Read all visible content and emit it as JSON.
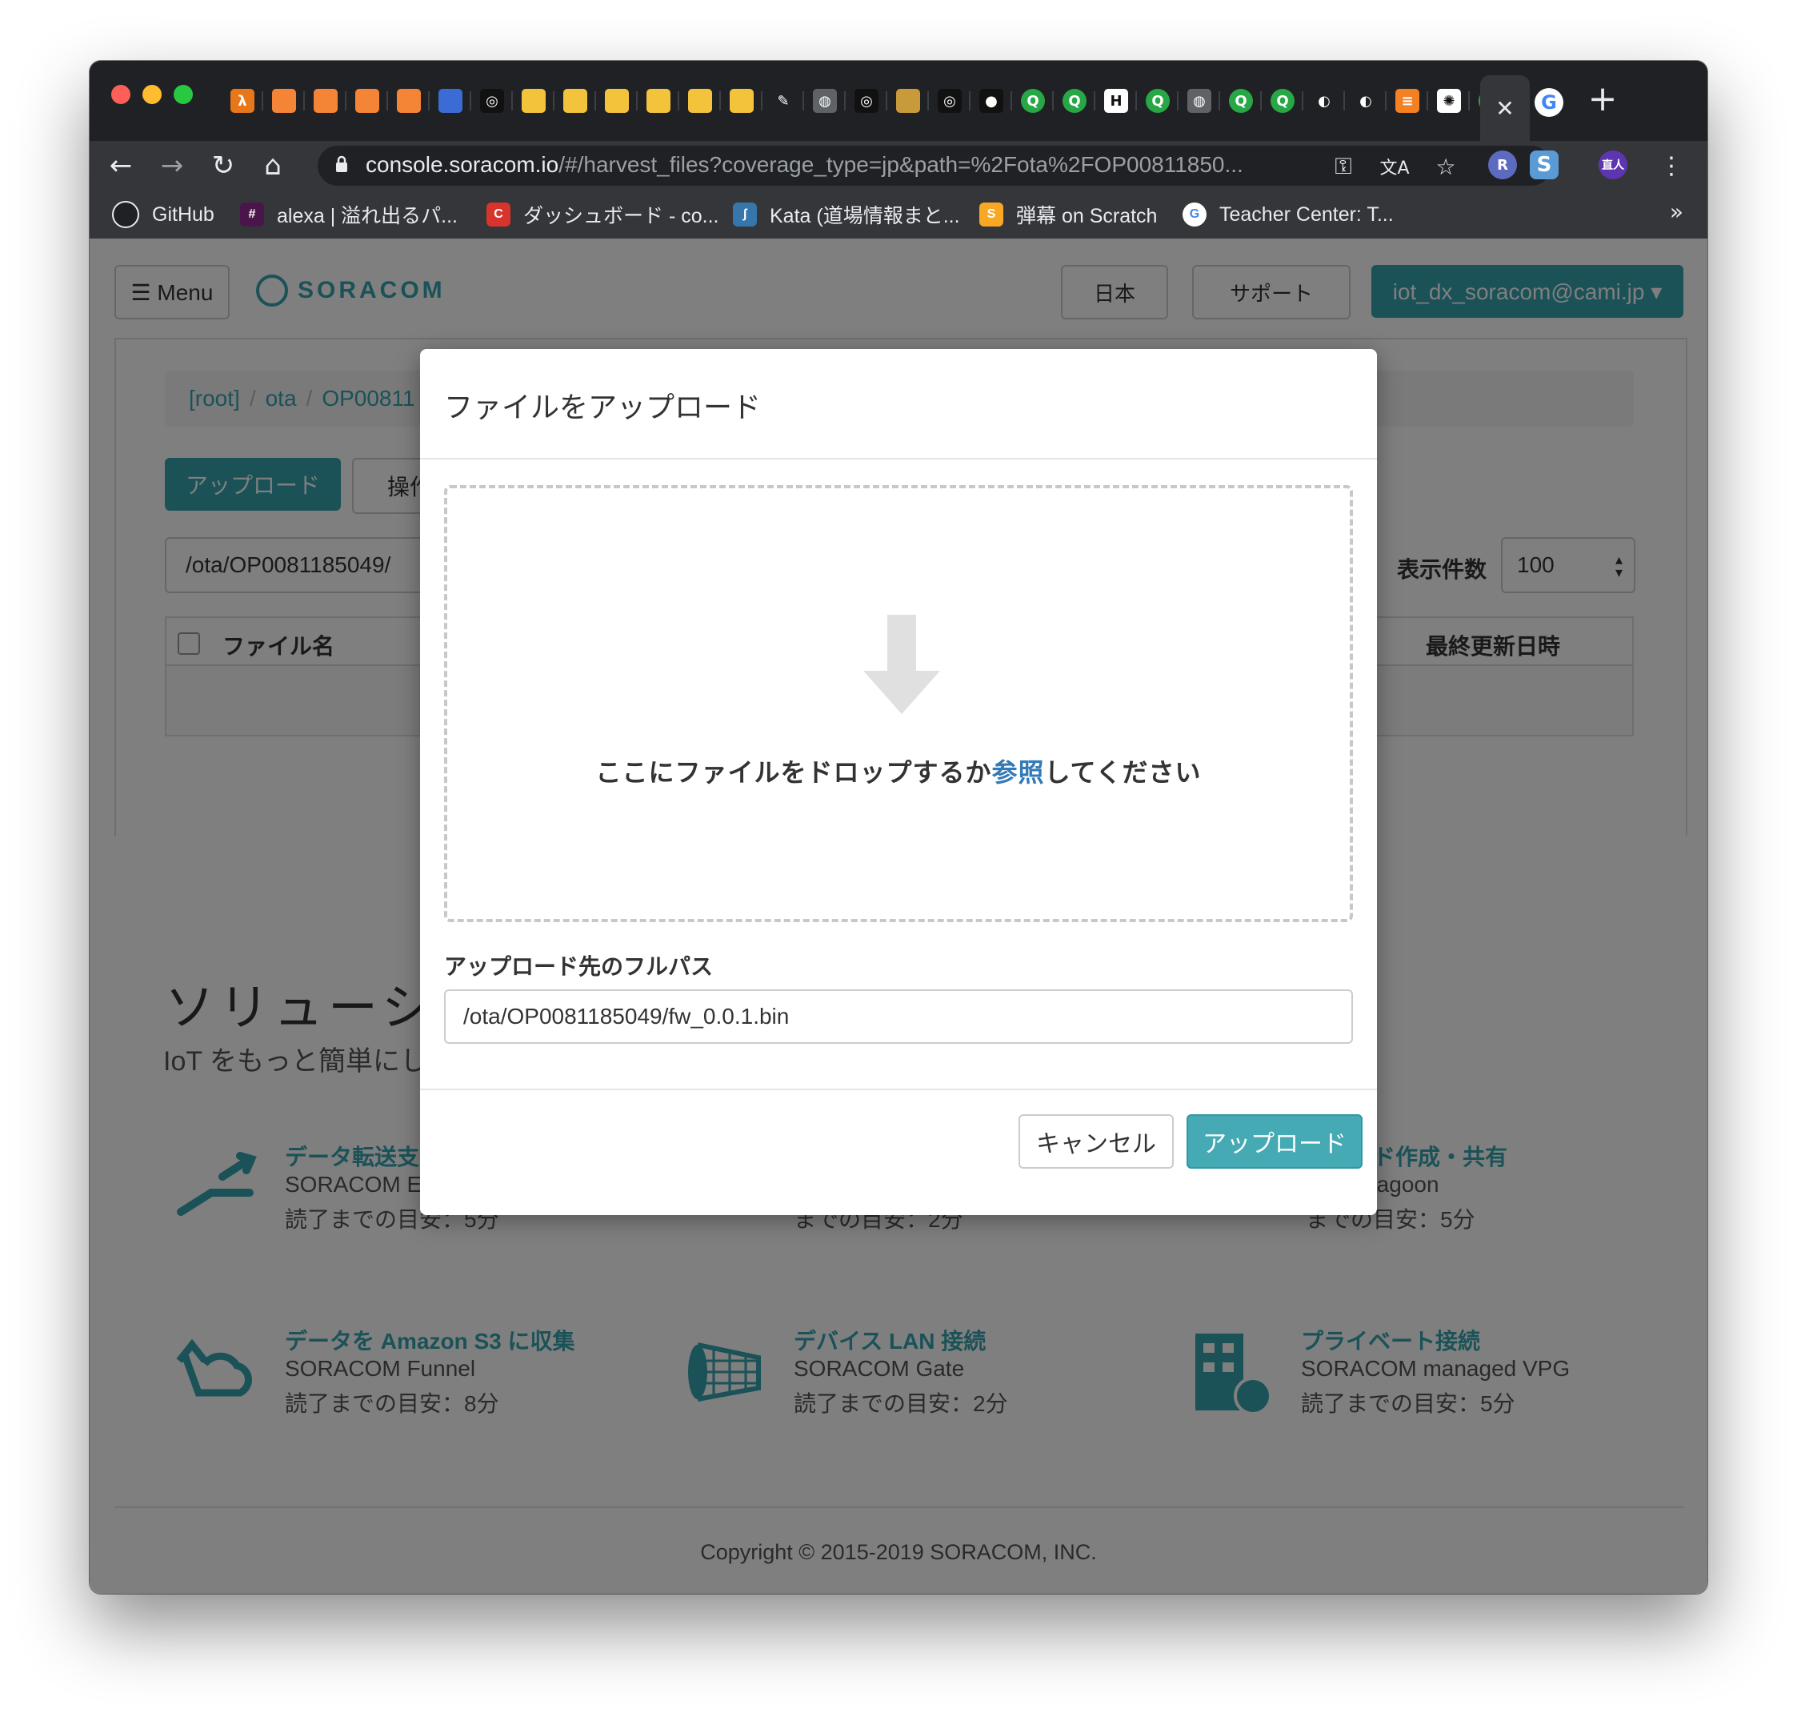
{
  "browser": {
    "tab_icons": [
      {
        "name": "aws-lambda-icon",
        "color": "#e8761a",
        "glyph": "λ"
      },
      {
        "name": "aws-box-icon",
        "color": "#f58536",
        "glyph": ""
      },
      {
        "name": "aws-box-icon",
        "color": "#f58536",
        "glyph": ""
      },
      {
        "name": "aws-box-icon",
        "color": "#f58536",
        "glyph": ""
      },
      {
        "name": "aws-box-icon",
        "color": "#f58536",
        "glyph": ""
      },
      {
        "name": "database-icon",
        "color": "#3b6bd4",
        "glyph": ""
      },
      {
        "name": "circle-logo-icon",
        "color": "#111111",
        "glyph": "◎"
      },
      {
        "name": "package-icon",
        "color": "#f3c33c",
        "glyph": ""
      },
      {
        "name": "package-icon",
        "color": "#f3c33c",
        "glyph": ""
      },
      {
        "name": "package-icon",
        "color": "#f3c33c",
        "glyph": ""
      },
      {
        "name": "package-icon",
        "color": "#f3c33c",
        "glyph": ""
      },
      {
        "name": "package-icon",
        "color": "#f3c33c",
        "glyph": ""
      },
      {
        "name": "package-icon",
        "color": "#f3c33c",
        "glyph": ""
      },
      {
        "name": "pen-icon",
        "color": "#202124",
        "glyph": "✎"
      },
      {
        "name": "globe-icon",
        "color": "#5f6368",
        "glyph": "◍"
      },
      {
        "name": "circle-logo-icon",
        "color": "#111111",
        "glyph": "◎"
      },
      {
        "name": "avatar-icon",
        "color": "#c99a3a",
        "glyph": ""
      },
      {
        "name": "circle-logo-icon",
        "color": "#111111",
        "glyph": "◎"
      },
      {
        "name": "dot-icon",
        "color": "#111111",
        "glyph": "●"
      },
      {
        "name": "q-icon",
        "color": "#27a745",
        "glyph": "Q"
      },
      {
        "name": "q-icon",
        "color": "#27a745",
        "glyph": "Q"
      },
      {
        "name": "h-icon",
        "color": "#ffffff",
        "glyph": "H"
      },
      {
        "name": "q-icon",
        "color": "#27a745",
        "glyph": "Q"
      },
      {
        "name": "globe-icon",
        "color": "#5f6368",
        "glyph": "◍"
      },
      {
        "name": "q-icon",
        "color": "#27a745",
        "glyph": "Q"
      },
      {
        "name": "q-icon",
        "color": "#27a745",
        "glyph": "Q"
      },
      {
        "name": "github-icon",
        "color": "#202124",
        "glyph": "◐"
      },
      {
        "name": "github-icon",
        "color": "#202124",
        "glyph": "◐"
      },
      {
        "name": "stack-icon",
        "color": "#f48024",
        "glyph": "≡"
      },
      {
        "name": "swirl-icon",
        "color": "#ffffff",
        "glyph": "✺"
      },
      {
        "name": "q-icon",
        "color": "#27a745",
        "glyph": "Q"
      }
    ],
    "active_tab_close": "✕",
    "new_tab": "+",
    "url_host": "console.soracom.io",
    "url_rest": "/#/harvest_files?coverage_type=jp&path=%2Fota%2FOP00811850...",
    "bookmarks": [
      {
        "label": "GitHub",
        "icon": "github-icon",
        "color": "#202124"
      },
      {
        "label": "alexa | 溢れ出るパ...",
        "icon": "slack-icon",
        "color": "#4a154b"
      },
      {
        "label": "ダッシュボード - co...",
        "icon": "c-icon",
        "color": "#d9342b"
      },
      {
        "label": "Kata (道場情報まと...",
        "icon": "python-icon",
        "color": "#3776ab"
      },
      {
        "label": "弾幕 on Scratch",
        "icon": "scratch-icon",
        "color": "#f9a825"
      },
      {
        "label": "Teacher Center: T...",
        "icon": "google-icon",
        "color": "#ffffff"
      }
    ],
    "bookmarks_more": "»",
    "profile_label": "直人"
  },
  "page": {
    "menu_label": "☰ Menu",
    "logo_text": "SORACOM",
    "lang_label": "日本",
    "support_label": "サポート",
    "user_label": "iot_dx_soracom@cami.jp ▾",
    "breadcrumb": [
      "[root]",
      "ota",
      "OP00811"
    ],
    "upload_label": "アップロード",
    "ops_label": "操作",
    "path_value": "/ota/OP0081185049/",
    "count_label": "表示件数",
    "count_value": "100",
    "col_filename": "ファイル名",
    "col_updated": "最終更新日時",
    "solutions_title": "ソリューショ",
    "solutions_sub": "IoT をもっと簡単にしよう",
    "solutions": [
      {
        "title": "データ転送支",
        "product": "SORACOM E",
        "read": "読了までの目安：5分"
      },
      {
        "title": "ュボード作成・共有",
        "product": "COM Lagoon",
        "read": "までの目安：5分"
      },
      {
        "title": "データを Amazon S3 に収集",
        "product": "SORACOM Funnel",
        "read": "読了までの目安：8分"
      },
      {
        "title": "デバイス LAN 接続",
        "product": "SORACOM Gate",
        "read": "読了までの目安：2分"
      },
      {
        "title": "プライベート接続",
        "product": "SORACOM managed VPG",
        "read": "読了までの目安：5分"
      },
      {
        "title": "",
        "product": "",
        "read": "までの目安：2分"
      }
    ],
    "copyright": "Copyright © 2015-2019 SORACOM, INC."
  },
  "modal": {
    "title": "ファイルをアップロード",
    "drop_text_before": "ここにファイルをドロップするか",
    "drop_text_link": "参照",
    "drop_text_after": "してください",
    "path_label": "アップロード先のフルパス",
    "path_value": "/ota/OP0081185049/fw_0.0.1.bin",
    "cancel_label": "キャンセル",
    "upload_label": "アップロード"
  }
}
